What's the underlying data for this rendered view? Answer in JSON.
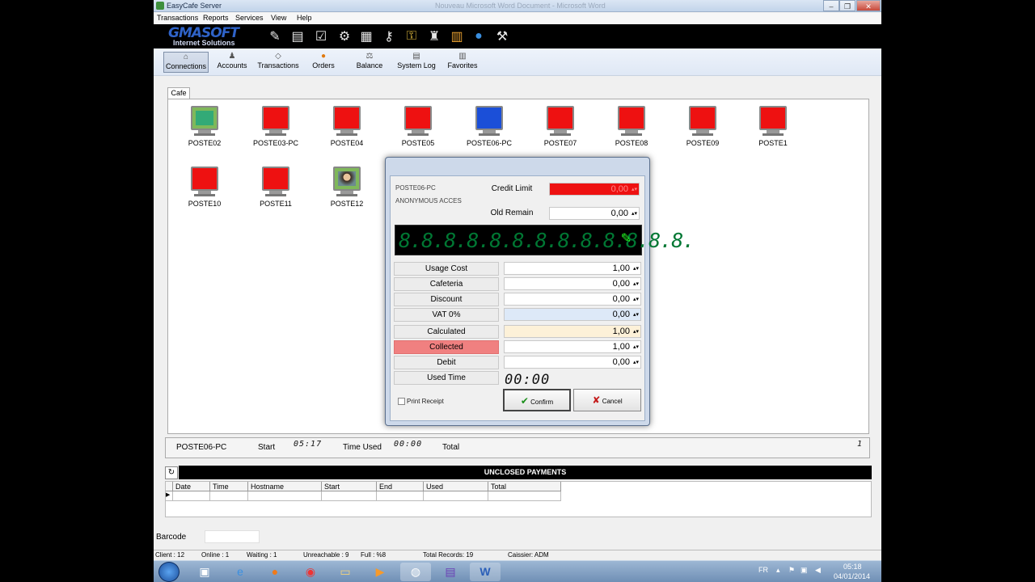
{
  "window": {
    "title": "EasyCafe Server",
    "background_title": "Nouveau Microsoft Word Document - Microsoft Word",
    "min": "–",
    "max": "❐",
    "close": "✕"
  },
  "menu": [
    "Transactions",
    "Reports",
    "Services",
    "View",
    "Help"
  ],
  "logo": {
    "name": "GMASOFT",
    "tagline": "Internet Solutions"
  },
  "toolbar_icons": [
    "notepad-icon",
    "documents-icon",
    "checklist-icon",
    "gears-icon",
    "calculator-icon",
    "keys-icon",
    "key-icon",
    "users-icon",
    "book-icon",
    "globe-icon",
    "tools-icon"
  ],
  "tabs": [
    {
      "label": "Connections",
      "icon": "⌂",
      "active": true
    },
    {
      "label": "Accounts",
      "icon": "♟"
    },
    {
      "label": "Transactions",
      "icon": "◇"
    },
    {
      "label": "Orders",
      "icon": "●"
    },
    {
      "label": "Balance",
      "icon": "⚖"
    },
    {
      "label": "System Log",
      "icon": "▤"
    },
    {
      "label": "Favorites",
      "icon": "▥"
    }
  ],
  "cafe_tab": "Cafe",
  "computers": [
    {
      "name": "POSTE02",
      "state": "green"
    },
    {
      "name": "POSTE03-PC",
      "state": "red"
    },
    {
      "name": "POSTE04",
      "state": "red"
    },
    {
      "name": "POSTE05",
      "state": "red"
    },
    {
      "name": "POSTE06-PC",
      "state": "blue"
    },
    {
      "name": "POSTE07",
      "state": "red"
    },
    {
      "name": "POSTE08",
      "state": "red"
    },
    {
      "name": "POSTE09",
      "state": "red"
    },
    {
      "name": "POSTE1",
      "state": "red"
    },
    {
      "name": "POSTE10",
      "state": "red"
    },
    {
      "name": "POSTE11",
      "state": "red"
    },
    {
      "name": "POSTE12",
      "state": "photo"
    }
  ],
  "status_row": {
    "host": "POSTE06-PC",
    "start_label": "Start",
    "start_time": "05:17",
    "time_used_label": "Time Used",
    "time_used": "00:00",
    "total_label": "Total",
    "total": "1"
  },
  "payments": {
    "title": "UNCLOSED PAYMENTS",
    "columns": [
      "Date",
      "Time",
      "Hostname",
      "Start",
      "End",
      "Used",
      "Total"
    ]
  },
  "barcode_label": "Barcode",
  "statusbar": {
    "client": "Client : 12",
    "online": "Online : 1",
    "waiting": "Waiting : 1",
    "unreachable": "Unreachable : 9",
    "full": "Full : %8",
    "total_records": "Total Records: 19",
    "cashier": "Caissier: ADM"
  },
  "dialog": {
    "host": "POSTE06-PC",
    "account": "ANONYMOUS ACCES",
    "credit_limit_label": "Credit Limit",
    "credit_limit": "0,00",
    "old_remain_label": "Old Remain",
    "old_remain": "0,00",
    "lcd": "8.8.8.8.8.8.8.8.8.8.8.8.8.",
    "rows": [
      {
        "label": "Usage Cost",
        "value": "1,00"
      },
      {
        "label": "Cafeteria",
        "value": "0,00"
      },
      {
        "label": "Discount",
        "value": "0,00"
      },
      {
        "label": "VAT 0%",
        "value": "0,00"
      },
      {
        "label": "Calculated",
        "value": "1,00"
      },
      {
        "label": "Collected",
        "value": "1,00"
      },
      {
        "label": "Debit",
        "value": "0,00"
      }
    ],
    "used_time_label": "Used Time",
    "used_time": "00:00",
    "print_receipt": "Print Receipt",
    "confirm": "Confirm",
    "cancel": "Cancel"
  },
  "taskbar": {
    "lang": "FR",
    "time": "05:18",
    "date": "04/01/2014"
  },
  "colors": {
    "red_monitor": "#ee1111",
    "blue_monitor": "#1b4fd8",
    "credit_limit_bg": "#ee1111",
    "collected_bg": "#f08080",
    "calculated_bg": "#fdf1d8",
    "vat_bg": "#dde9f8"
  }
}
